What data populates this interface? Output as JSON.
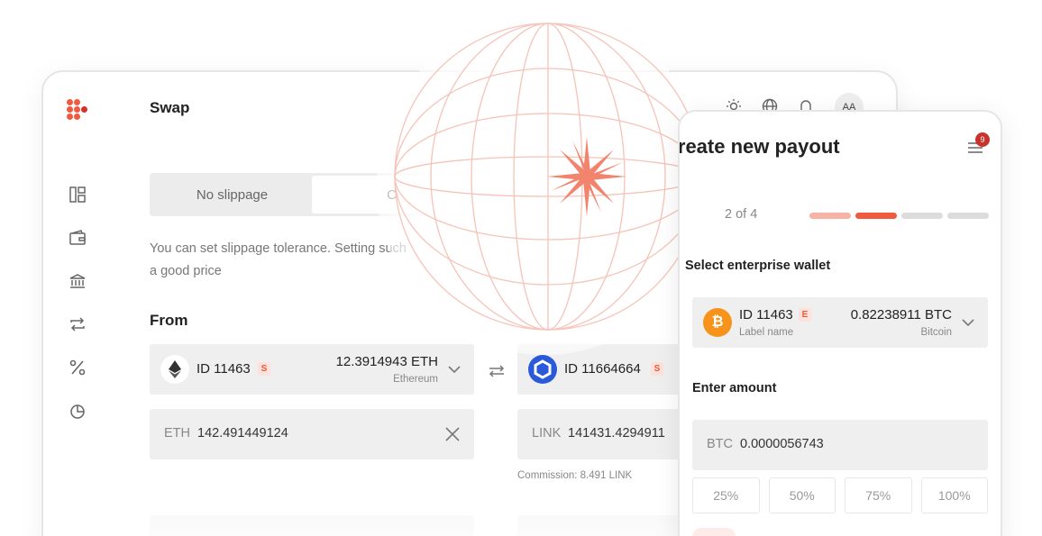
{
  "header": {
    "title": "Swap",
    "avatar_initials": "AA"
  },
  "swap": {
    "segments": [
      "No slippage",
      "C"
    ],
    "hint": "You can set slippage tolerance. Setting such a good price",
    "from_label": "From",
    "from_token": {
      "id": "ID 11463",
      "badge": "S",
      "amount": "12.3914943 ETH",
      "network": "Ethereum"
    },
    "to_token": {
      "id": "ID 11664664",
      "badge": "S"
    },
    "from_input": {
      "currency": "ETH",
      "value": "142.491449124"
    },
    "to_input": {
      "currency": "LINK",
      "value": "141431.4294911"
    },
    "commission": "Commission: 8.491 LINK"
  },
  "payout": {
    "title": "Create new payout",
    "notification_count": "9",
    "step": "2 of 4",
    "wallet_section": "Select enterprise wallet",
    "wallet": {
      "id": "ID 11463",
      "badge": "E",
      "label": "Label name",
      "amount": "0.82238911 BTC",
      "network": "Bitcoin"
    },
    "amount_section": "Enter amount",
    "amount_input": {
      "currency": "BTC",
      "value": "0.0000056743"
    },
    "percent_buttons": [
      "25%",
      "50%",
      "75%",
      "100%"
    ]
  },
  "colors": {
    "accent": "#f05a3e",
    "accent_light": "#f7b3a6",
    "step_inactive": "#dcdcdc",
    "bitcoin": "#f7931a",
    "chainlink": "#2a5ada"
  }
}
